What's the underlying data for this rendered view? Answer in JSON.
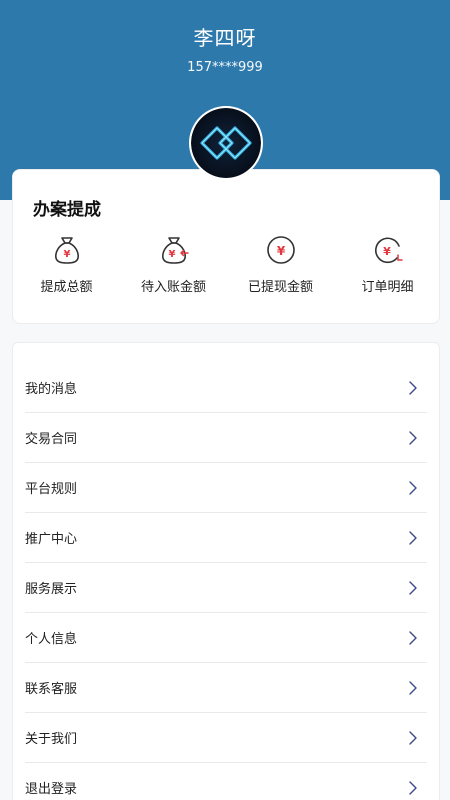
{
  "profile": {
    "name": "李四呀",
    "phone": "157****999",
    "avatar_icon": "neon-diamond-logo-icon"
  },
  "commission": {
    "title": "办案提成",
    "items": [
      {
        "label": "提成总额",
        "icon": "money-bag-icon"
      },
      {
        "label": "待入账金额",
        "icon": "money-bag-incoming-icon"
      },
      {
        "label": "已提现金额",
        "icon": "yen-coin-icon"
      },
      {
        "label": "订单明细",
        "icon": "yen-clock-icon"
      }
    ]
  },
  "menu": {
    "items": [
      {
        "label": "我的消息"
      },
      {
        "label": "交易合同"
      },
      {
        "label": "平台规则"
      },
      {
        "label": "推广中心"
      },
      {
        "label": "服务展示"
      },
      {
        "label": "个人信息"
      },
      {
        "label": "联系客服"
      },
      {
        "label": "关于我们"
      },
      {
        "label": "退出登录"
      }
    ]
  },
  "colors": {
    "header": "#2e79ac",
    "icon_red": "#e0383e",
    "icon_dark": "#333333",
    "chevron": "#3a4a8a"
  }
}
